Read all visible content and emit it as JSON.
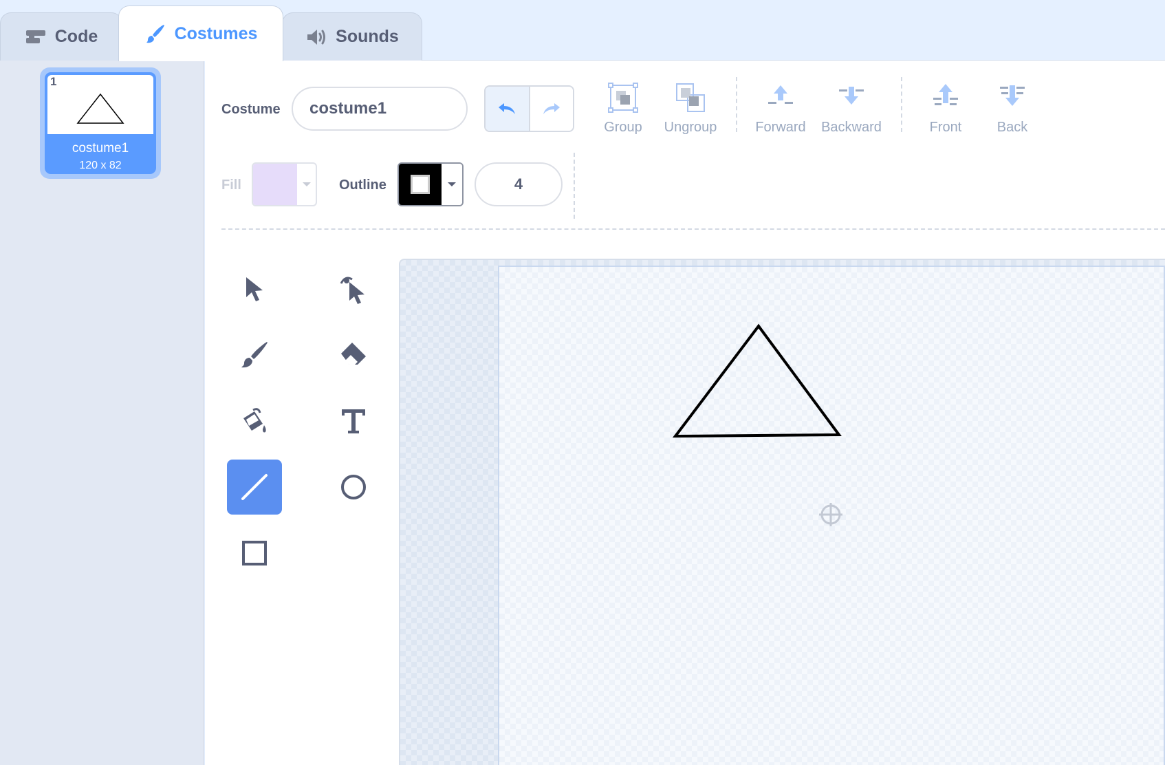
{
  "tabs": [
    {
      "label": "Code",
      "icon": "code-blocks-icon"
    },
    {
      "label": "Costumes",
      "icon": "paintbrush-icon",
      "active": true
    },
    {
      "label": "Sounds",
      "icon": "speaker-icon"
    }
  ],
  "costume_list": [
    {
      "number": "1",
      "name": "costume1",
      "size": "120 x 82",
      "selected": true
    }
  ],
  "toolbar": {
    "costume_label": "Costume",
    "costume_name": "costume1",
    "group_label": "Group",
    "ungroup_label": "Ungroup",
    "forward_label": "Forward",
    "backward_label": "Backward",
    "front_label": "Front",
    "back_label": "Back",
    "fill_label": "Fill",
    "fill_color": "#e6dcfa",
    "outline_label": "Outline",
    "outline_color": "#000000",
    "outline_width": "4"
  },
  "tools": {
    "selected": "line-tool",
    "list": [
      "select-tool",
      "reshape-tool",
      "brush-tool",
      "eraser-tool",
      "fill-tool",
      "text-tool",
      "line-tool",
      "circle-tool",
      "rectangle-tool"
    ]
  },
  "colors": {
    "accent": "#4c97ff",
    "active_tool": "#5b8ff0",
    "text": "#575e75"
  }
}
